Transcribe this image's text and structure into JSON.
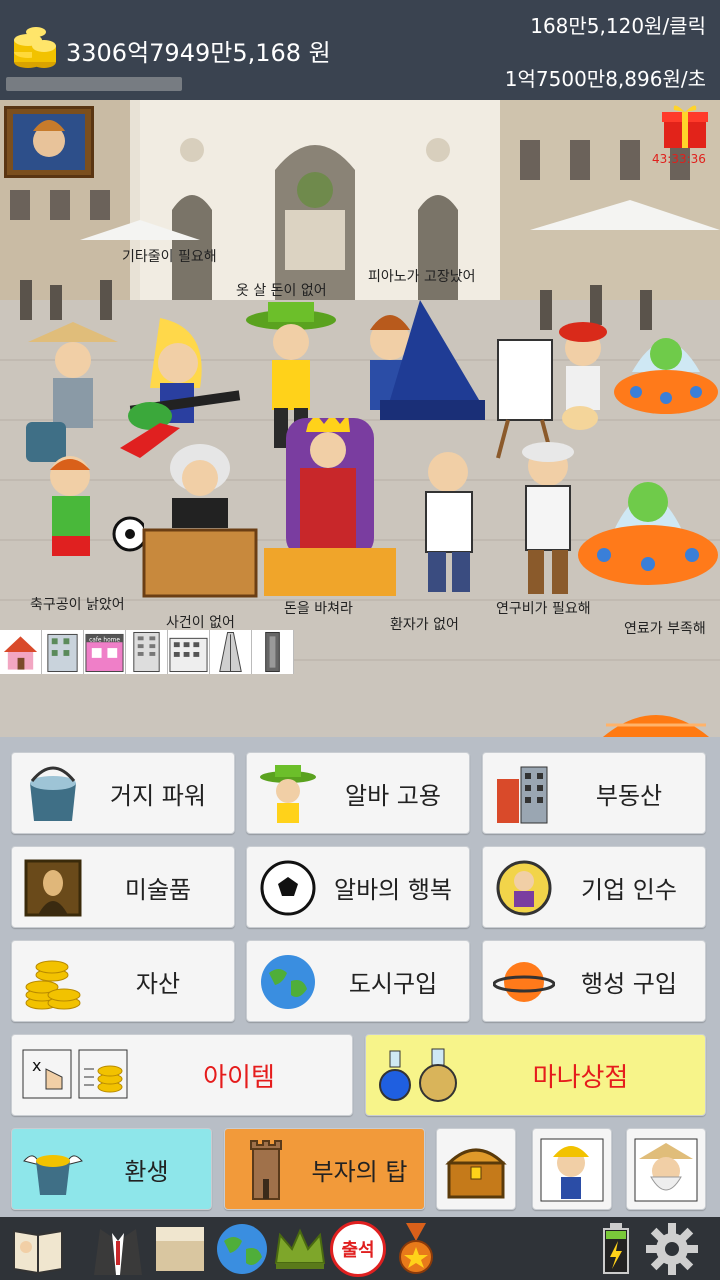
{
  "header": {
    "money_total": "3306억7949만5,168 원",
    "per_click": "168만5,120원/클릭",
    "per_second": "1억7500만8,896원/초",
    "progress": 0.0
  },
  "scene": {
    "gift_timer": "43:33:36",
    "labels": {
      "guitar": "기타줄이 필요해",
      "clothes": "옷 살 돈이 없어",
      "piano": "피아노가 고장났어",
      "soccer": "축구공이 낡았어",
      "case": "사건이 없어",
      "money": "돈을 바쳐라",
      "patient": "환자가 없어",
      "research": "연구비가 필요해",
      "fuel": "연료가 부족해"
    },
    "buildings_bar": [
      "house",
      "apartment",
      "cafe",
      "building",
      "office",
      "skyscraper",
      "tower"
    ],
    "cafe_text": "cafe home"
  },
  "menu": {
    "beggar_power": "거지 파워",
    "hire_alba": "알바 고용",
    "real_estate": "부동산",
    "art": "미술품",
    "alba_happiness": "알바의 행복",
    "acquisition": "기업 인수",
    "assets": "자산",
    "buy_city": "도시구입",
    "buy_planet": "행성 구입",
    "items": "아이템",
    "mana_shop": "마나상점",
    "rebirth": "환생",
    "rich_tower": "부자의 탑"
  },
  "bottom": {
    "attendance": "출석"
  },
  "colors": {
    "header_bg": "#3a4350",
    "panel_bg": "#b8bec6",
    "item_red": "#e51c1c",
    "mana_bg": "#f7f48a",
    "rebirth_bg": "#8ee6ea",
    "tower_bg": "#f29a3a",
    "timer_red": "#e0201c"
  }
}
